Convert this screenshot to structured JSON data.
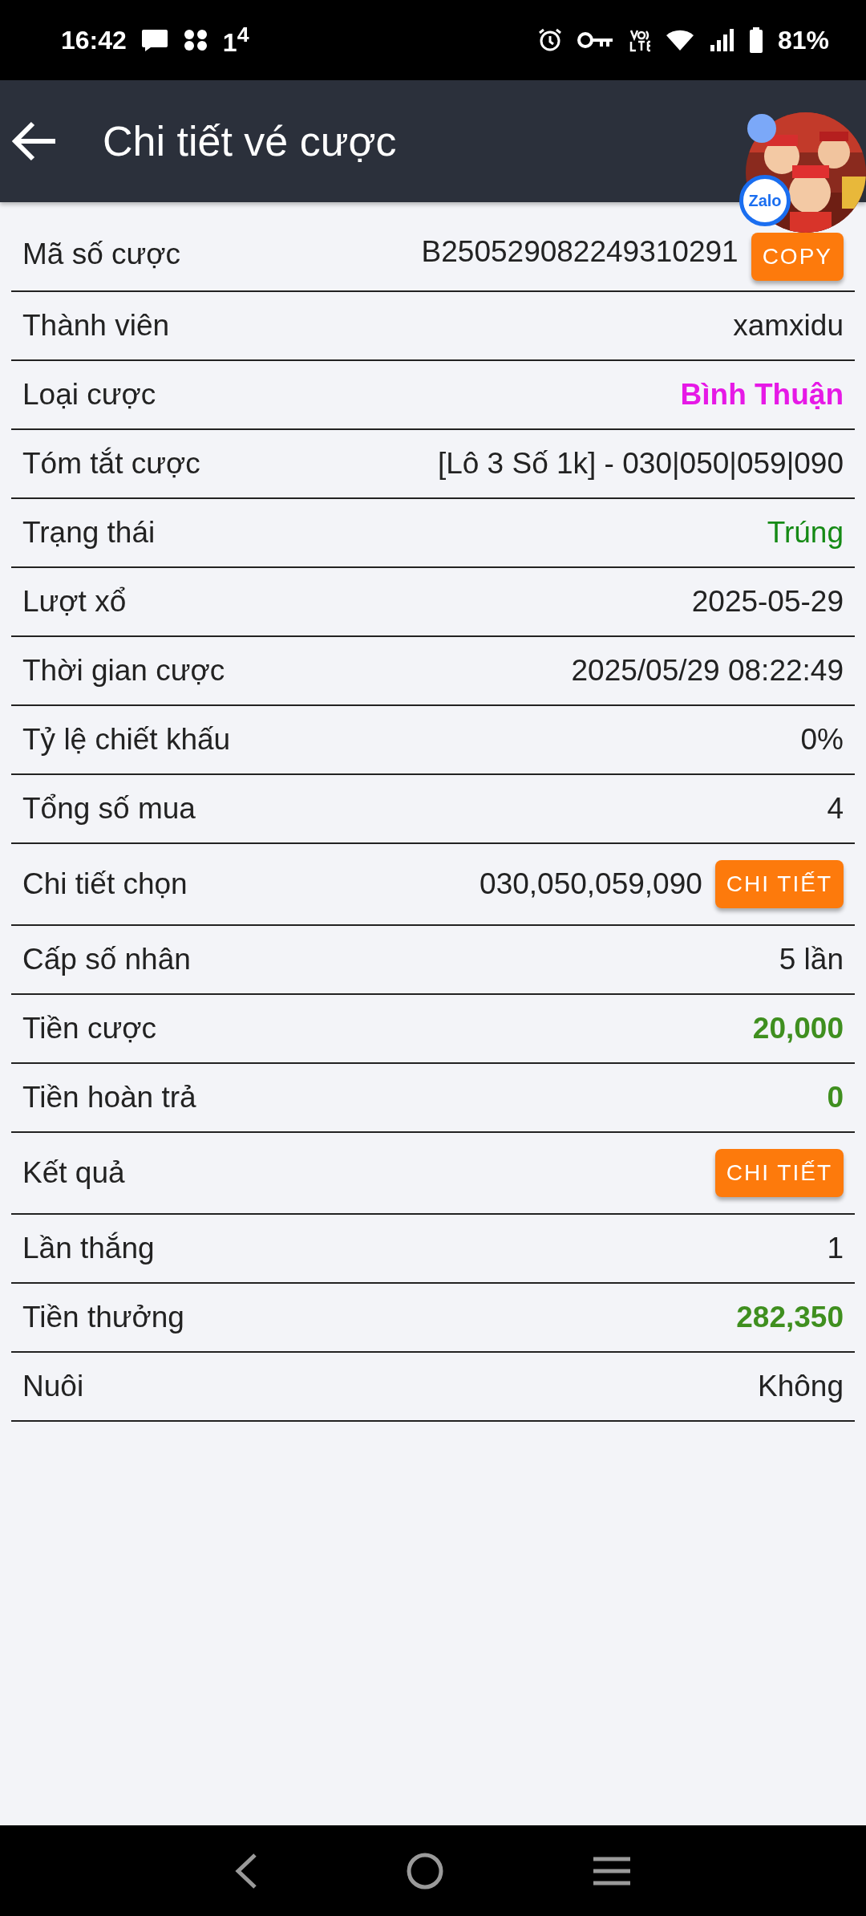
{
  "status_bar": {
    "time": "16:42",
    "notification": "1$^{4}$",
    "battery": "81%"
  },
  "header": {
    "title": "Chi tiết vé cược"
  },
  "chat_bubble": {
    "kind": "picture",
    "badge": "Zalo"
  },
  "rows": [
    {
      "kind": "value_button",
      "label": "Mã số cược",
      "value": "B250529082249310291",
      "button": "COPY",
      "bold": false
    },
    {
      "kind": "value",
      "label": "Thành viên",
      "value": "xamxidu",
      "bold": false
    },
    {
      "kind": "value",
      "label": "Loại cược",
      "value": "Bình Thuận",
      "bold": true,
      "color": "#e619e6"
    },
    {
      "kind": "value",
      "label": "Tóm tắt cược",
      "value": "[Lô 3 Số 1k] - 030|050|059|090",
      "bold": false
    },
    {
      "kind": "value",
      "label": "Trạng thái",
      "value": "Trúng",
      "bold": false,
      "color": "#158a15"
    },
    {
      "kind": "value",
      "label": "Lượt xổ",
      "value": "2025-05-29",
      "bold": false
    },
    {
      "kind": "value",
      "label": "Thời gian cược",
      "value": "2025/05/29 08:22:49",
      "bold": false
    },
    {
      "kind": "value",
      "label": "Tỷ lệ chiết khấu",
      "value": "0%",
      "bold": false
    },
    {
      "kind": "value",
      "label": "Tổng số mua",
      "value": "4",
      "bold": false
    },
    {
      "kind": "value_button",
      "label": "Chi tiết chọn",
      "value": "030,050,059,090",
      "button": "CHI TIẾT",
      "bold": false
    },
    {
      "kind": "value",
      "label": "Cấp số nhân",
      "value": "5 lần",
      "bold": false
    },
    {
      "kind": "value",
      "label": "Tiền cược",
      "value": "20,000",
      "bold": true,
      "color": "#3f8f1f"
    },
    {
      "kind": "value",
      "label": "Tiền hoàn trả",
      "value": "0",
      "bold": true,
      "color": "#3f8f1f"
    },
    {
      "kind": "button",
      "label": "Kết quả",
      "button": "CHI TIẾT"
    },
    {
      "kind": "value",
      "label": "Lần thắng",
      "value": "1",
      "bold": false
    },
    {
      "kind": "value",
      "label": "Tiền thưởng",
      "value": "282,350",
      "bold": true,
      "color": "#3f8f1f"
    },
    {
      "kind": "value",
      "label": "Nuôi",
      "value": "Không",
      "bold": false
    }
  ]
}
